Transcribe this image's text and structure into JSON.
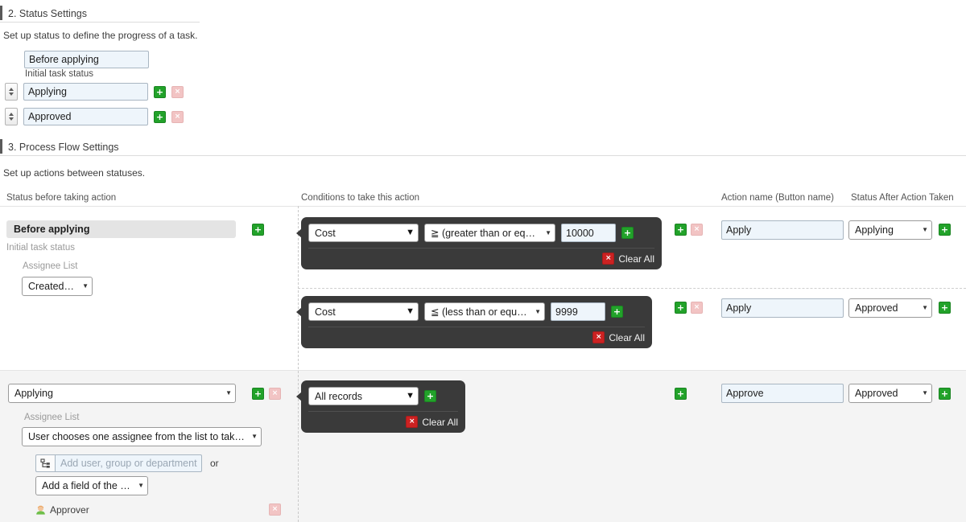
{
  "sections": {
    "status": {
      "heading": "2. Status Settings",
      "lede": "Set up status to define the progress of a task.",
      "initial_status_value": "Before applying",
      "initial_status_note": "Initial task status",
      "rows": [
        {
          "value": "Applying",
          "add_label": "+",
          "delete_label": "×"
        },
        {
          "value": "Approved",
          "add_label": "+",
          "delete_label": "×"
        }
      ]
    },
    "flow": {
      "heading": "3. Process Flow Settings",
      "lede": "Set up actions between statuses.",
      "columns": {
        "status_before": "Status before taking action",
        "conditions": "Conditions to take this action",
        "action_name": "Action name (Button name)",
        "status_after": "Status After Action Taken"
      },
      "groups": [
        {
          "status_before": {
            "type": "pill",
            "value": "Before applying",
            "note": "Initial task status",
            "assignee_label": "Assignee List",
            "assignee_select": "Created by",
            "add_label": "+"
          },
          "transitions": [
            {
              "condition": {
                "field": "Cost",
                "operator": "≧ (greater than or equal to)",
                "value": "10000",
                "add_label": "+",
                "clear_all": "Clear All",
                "clear_icon": "×"
              },
              "add_label": "+",
              "delete_label": "×",
              "action_name": "Apply",
              "status_after": "Applying",
              "status_after_add": "+"
            },
            {
              "condition": {
                "field": "Cost",
                "operator": "≦ (less than or equal to)",
                "value": "9999",
                "add_label": "+",
                "clear_all": "Clear All",
                "clear_icon": "×"
              },
              "add_label": "+",
              "delete_label": "×",
              "action_name": "Apply",
              "status_after": "Approved",
              "status_after_add": "+"
            }
          ]
        },
        {
          "status_before": {
            "type": "select",
            "value": "Applying",
            "assignee_label": "Assignee List",
            "assignee_select": "User chooses one assignee from the list to take action",
            "picker_placeholder": "Add user, group or department",
            "picker_icon": "org-tree-icon",
            "or_label": "or",
            "field_select": "Add a field of the form",
            "assignees": [
              {
                "name": "Approver",
                "icon": "user-avatar-icon",
                "delete_label": "×"
              }
            ],
            "add_label": "+",
            "delete_label": "×"
          },
          "transitions": [
            {
              "condition": {
                "field": "All records",
                "add_label": "+",
                "clear_all": "Clear All",
                "clear_icon": "×"
              },
              "add_label": "+",
              "action_name": "Approve",
              "status_after": "Approved",
              "status_after_add": "+"
            }
          ]
        }
      ]
    }
  },
  "colors": {
    "accent_green": "#22a22a",
    "danger_red": "#cc2222",
    "card_dark": "#3a3a3a",
    "input_blue": "#eef5fb",
    "band_gray": "#f4f4f4"
  }
}
